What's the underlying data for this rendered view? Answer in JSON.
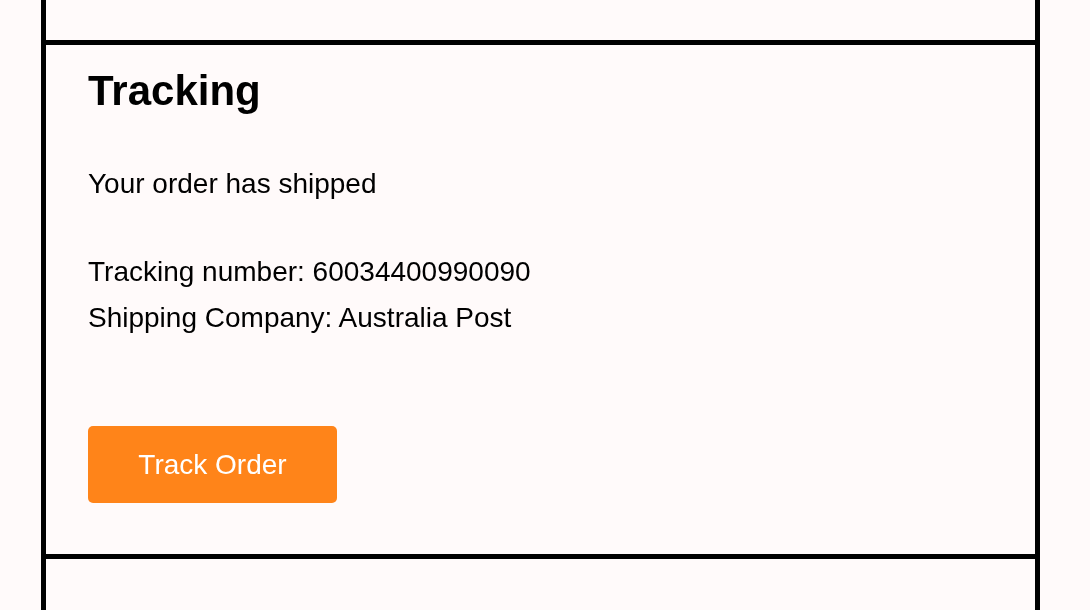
{
  "title": "Tracking",
  "status": "Your order has shipped",
  "details": [
    "Tracking number: 60034400990090",
    "Shipping Company: Australia Post"
  ],
  "button": "Track Order"
}
